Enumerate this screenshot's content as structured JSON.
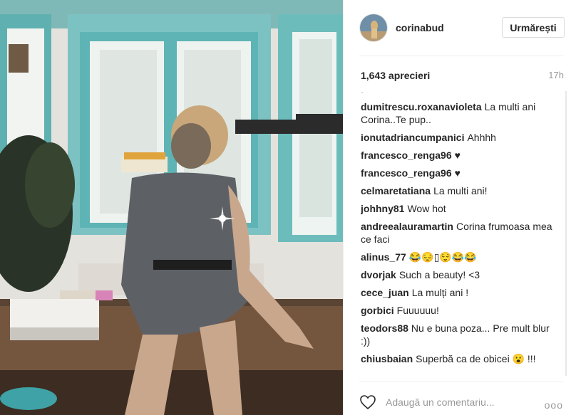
{
  "post": {
    "username": "corinabud",
    "follow_label": "Urmărești",
    "likes": "1,643 aprecieri",
    "time": "17h",
    "comments_more_indicator": "·",
    "add_comment_placeholder": "Adaugă un comentariu...",
    "more_icon": "ooo"
  },
  "comments": [
    {
      "user": "dumitrescu.roxanavioleta",
      "text": "La multi ani Corina..Te pup.."
    },
    {
      "user": "ionutadriancumpanici",
      "text": "Ahhhh"
    },
    {
      "user": "francesco_renga96",
      "text": "♥"
    },
    {
      "user": "francesco_renga96",
      "text": "♥"
    },
    {
      "user": "celmaretatiana",
      "text": "La multi ani!"
    },
    {
      "user": "johhny81",
      "text": "Wow hot"
    },
    {
      "user": "andreealauramartin",
      "text": "Corina frumoasa mea ce faci"
    },
    {
      "user": "alinus_77",
      "text": "😂😔▯😌😂😂"
    },
    {
      "user": "dvorjak",
      "text": "Such a beauty! <3"
    },
    {
      "user": "cece_juan",
      "text": "La mulți ani !"
    },
    {
      "user": "gorbici",
      "text": "Fuuuuuu!"
    },
    {
      "user": "teodors88",
      "text": "Nu e buna poza... Pre mult blur :))"
    },
    {
      "user": "chiusbaian",
      "text": "Superbă ca de obicei 😮 !!!"
    }
  ],
  "icons": {
    "heart": "heart-icon",
    "options": "more-options-icon",
    "avatar": "avatar"
  }
}
